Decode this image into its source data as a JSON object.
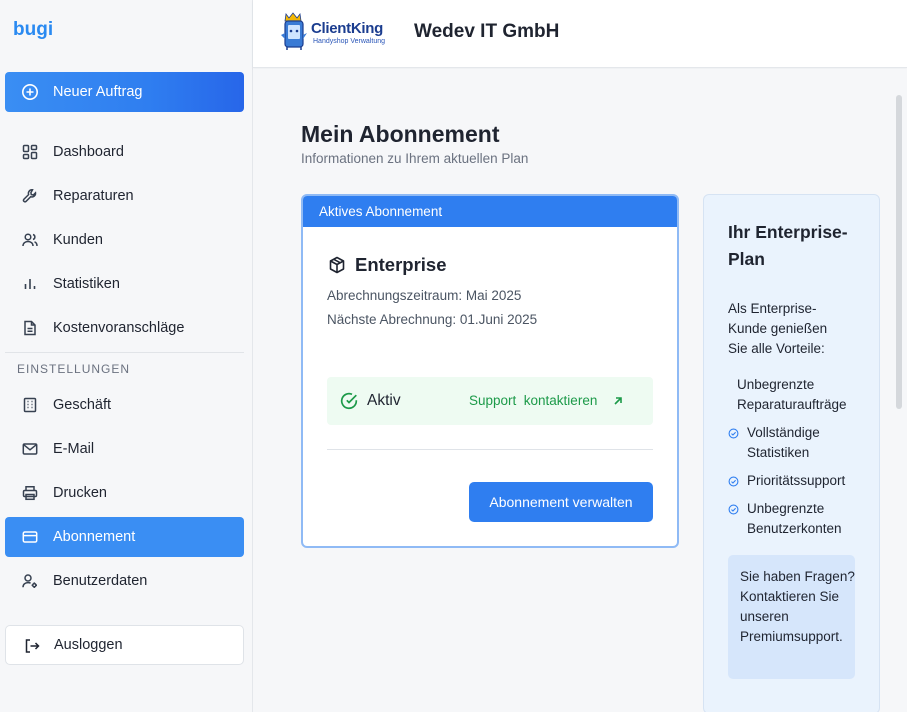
{
  "sidebar": {
    "brand": "bugi",
    "new_order": {
      "label": "Neuer Auftrag",
      "icon": "plus-circle-icon"
    },
    "items": [
      {
        "label": "Dashboard",
        "icon": "dashboard-icon"
      },
      {
        "label": "Reparaturen",
        "icon": "wrench-icon"
      },
      {
        "label": "Kunden",
        "icon": "users-icon"
      },
      {
        "label": "Statistiken",
        "icon": "bar-chart-icon"
      },
      {
        "label": "Kostenvoranschläge",
        "icon": "document-icon"
      }
    ],
    "settings_title": "EINSTELLUNGEN",
    "settings_items": [
      {
        "label": "Geschäft",
        "icon": "building-icon"
      },
      {
        "label": "E-Mail",
        "icon": "mail-icon"
      },
      {
        "label": "Drucken",
        "icon": "printer-icon"
      },
      {
        "label": "Abonnement",
        "icon": "credit-card-icon",
        "active": true
      },
      {
        "label": "Benutzerdaten",
        "icon": "user-settings-icon"
      }
    ],
    "logout": {
      "label": "Ausloggen",
      "icon": "logout-icon"
    }
  },
  "header": {
    "logo_word": "ClientKing",
    "logo_sub": "Handyshop Verwaltung",
    "company": "Wedev IT GmbH"
  },
  "main": {
    "title": "Mein Abonnement",
    "subtitle": "Informationen zu Ihrem aktuellen Plan",
    "card": {
      "header": "Aktives Abonnement",
      "plan": "Enterprise",
      "period": "Abrechnungszeitraum: Mai 2025",
      "next_billing": "Nächste Abrechnung: 01.Juni 2025",
      "status": "Aktiv",
      "support_link": "Support  kontaktieren",
      "manage_button": "Abonnement verwalten"
    },
    "promo": {
      "title": "Ihr Enterprise-Plan",
      "intro": "Als Enterprise-Kunde genießen Sie alle Vorteile:",
      "features": [
        "Unbegrenzte Reparaturaufträge",
        "Vollständige Statistiken",
        "Prioritätssupport",
        "Unbegrenzte Benutzerkonten"
      ],
      "contact_box": "Sie haben Fragen? Kontaktieren Sie unseren Premiumsupport."
    }
  },
  "colors": {
    "accent": "#2f7ef0",
    "success": "#1c9a49",
    "success_bg": "#eefbf2",
    "promo_bg": "#eaf3fd"
  }
}
